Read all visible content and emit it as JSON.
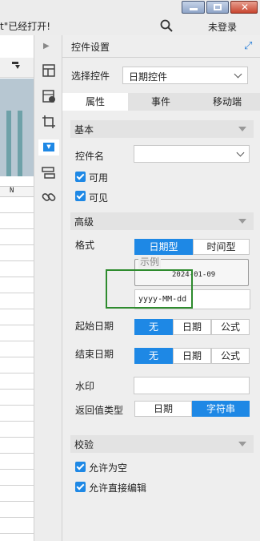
{
  "window": {
    "message": "t\"已经打开!",
    "login_label": "未登录",
    "icons": [
      "minimize-icon",
      "restore-icon",
      "close-icon",
      "search-icon"
    ]
  },
  "canvas": {
    "column_header": "N"
  },
  "toolbar": {
    "icons": [
      "collapse-arrow-icon",
      "widget-settings-icon",
      "cell-properties-icon",
      "crop-icon",
      "dropdown-widget-icon",
      "layout-icon",
      "link-icon"
    ]
  },
  "panel": {
    "title": "控件设置",
    "select_label": "选择控件",
    "select_value": "日期控件",
    "tabs": [
      "属性",
      "事件",
      "移动端"
    ],
    "basic": {
      "header": "基本",
      "name_label": "控件名",
      "name_value": "",
      "visible_label": "可用",
      "enabled_label": "可见",
      "available_checked": true,
      "visible_checked": true
    },
    "advanced": {
      "header": "高级",
      "format_label": "格式",
      "format_options": [
        "日期型",
        "时间型"
      ],
      "format_selected": "日期型",
      "example_label": "示例",
      "example_value": "2024-01-09",
      "format_pattern": "yyyy-MM-dd",
      "start_label": "起始日期",
      "start_options": [
        "无",
        "日期",
        "公式"
      ],
      "start_selected": "无",
      "end_label": "结束日期",
      "end_options": [
        "无",
        "日期",
        "公式"
      ],
      "end_selected": "无",
      "watermark_label": "水印",
      "watermark_value": "",
      "return_label": "返回值类型",
      "return_options": [
        "日期",
        "字符串"
      ],
      "return_selected": "字符串"
    },
    "validation": {
      "header": "校验",
      "allow_empty": "允许为空",
      "allow_edit": "允许直接编辑",
      "allow_empty_checked": true,
      "allow_edit_checked": true
    }
  },
  "colors": {
    "accent": "#1e88e5",
    "highlight_box": "#2e8b2e"
  }
}
